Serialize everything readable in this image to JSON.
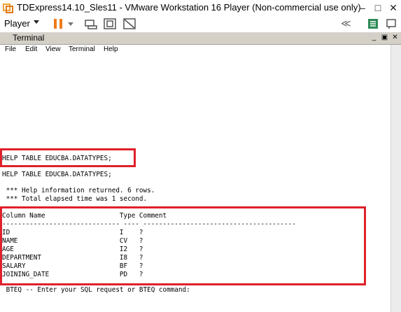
{
  "window": {
    "title": "TDExpress14.10_Sles11 - VMware Workstation 16 Player (Non-commercial use only)"
  },
  "toolbar": {
    "player_label": "Player"
  },
  "terminal": {
    "title": "Terminal",
    "menu": [
      "File",
      "Edit",
      "View",
      "Terminal",
      "Help"
    ],
    "lines": [
      "HELP TABLE EDUCBA.DATATYPES;",
      "HELP TABLE EDUCBA.DATATYPES;",
      " *** Help information returned. 6 rows.",
      " *** Total elapsed time was 1 second.",
      "Column Name                   Type Comment",
      "------------------------------ ---- ---------------------------------------",
      "ID                            I    ?",
      "NAME                          CV   ?",
      "AGE                           I2   ?",
      "DEPARTMENT                    I8   ?",
      "SALARY                        BF   ?",
      "JOINING_DATE                  PD   ?",
      " BTEQ -- Enter your SQL request or BTEQ command:"
    ]
  },
  "colors": {
    "highlight": "#e0202a",
    "pause_icon": "#f07a1a",
    "library_icon": "#2e8b57"
  }
}
